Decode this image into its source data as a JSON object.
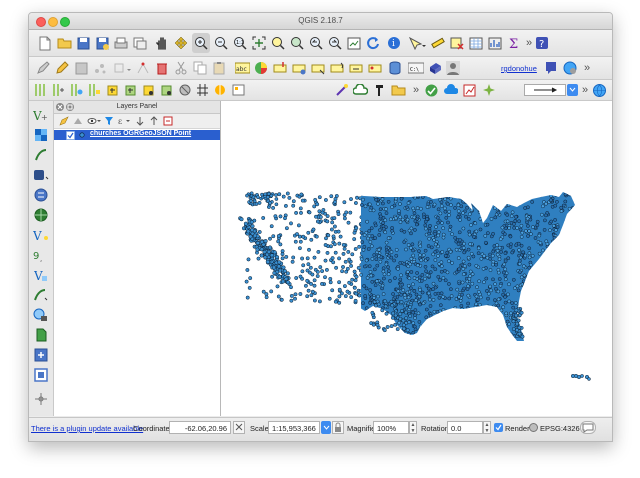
{
  "window": {
    "title": "QGIS 2.18.7"
  },
  "toolbar": {
    "user_label": "rgdonohue",
    "collapse_glyph": "»"
  },
  "layers_panel": {
    "title": "Layers Panel",
    "layers": [
      {
        "name": "churches OGRGeoJSON Point",
        "checked": true
      }
    ]
  },
  "statusbar": {
    "plugin_update_link": "There is a plugin update available",
    "coordinate_label": "Coordinate",
    "coordinate_value": "-62.06,20.96",
    "scale_label": "Scale",
    "scale_value": "1:15,953,366",
    "magnifier_label": "Magnifier",
    "magnifier_value": "100%",
    "rotation_label": "Rotation",
    "rotation_value": "0.0",
    "render_label": "Render",
    "render_checked": true,
    "crs_value": "EPSG:4326"
  },
  "colors": {
    "point_fill": "#3a8fd0",
    "point_stroke": "#0b1f33",
    "selection": "#2a5fcf",
    "link": "#1030d0"
  }
}
